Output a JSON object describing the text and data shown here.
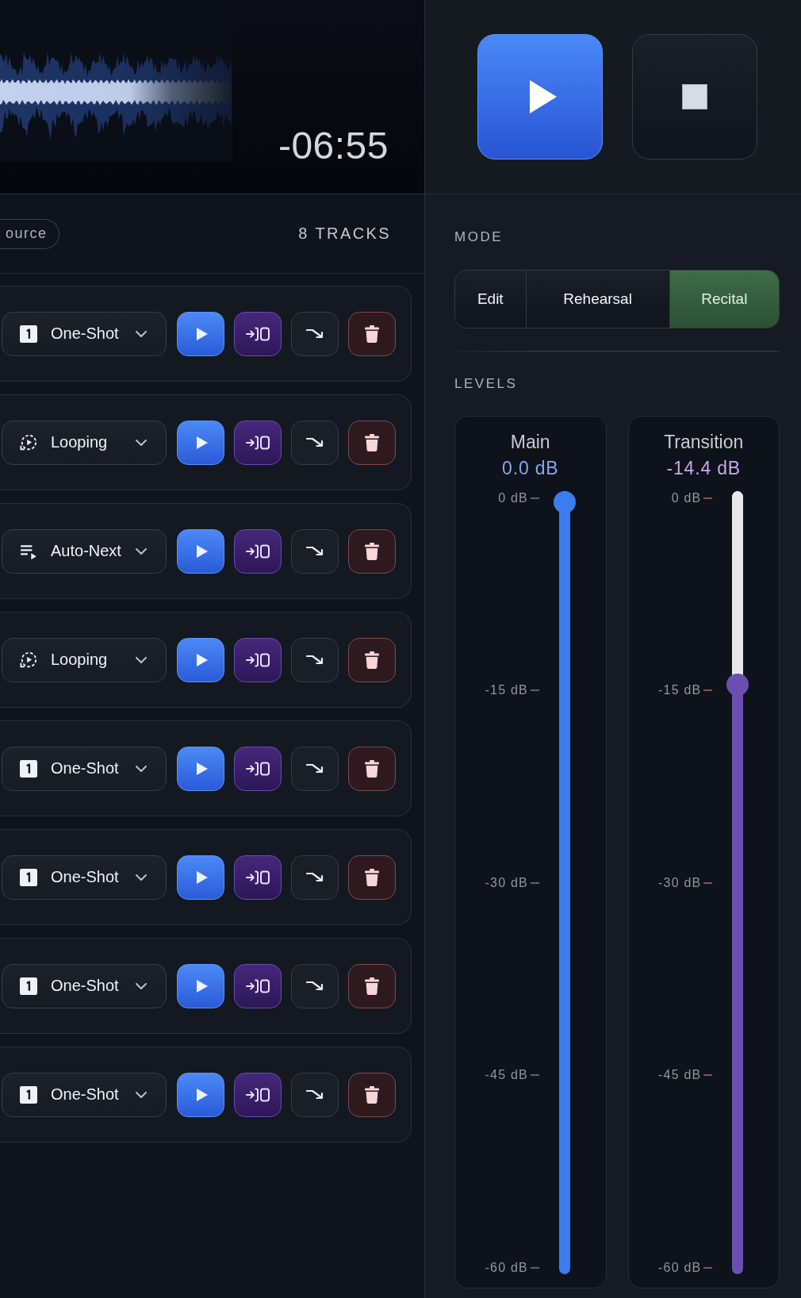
{
  "transport": {
    "time_remaining": "-06:55",
    "controls": [
      {
        "kind": "play"
      },
      {
        "kind": "stop"
      }
    ]
  },
  "tracks": {
    "source_chip": "ource",
    "count": "8 TRACKS",
    "items": [
      {
        "mode": {
          "kind": "one_shot",
          "label": "One-Shot"
        }
      },
      {
        "mode": {
          "kind": "looping",
          "label": "Looping"
        }
      },
      {
        "mode": {
          "kind": "auto_next",
          "label": "Auto-Next"
        }
      },
      {
        "mode": {
          "kind": "looping",
          "label": "Looping"
        }
      },
      {
        "mode": {
          "kind": "one_shot",
          "label": "One-Shot"
        }
      },
      {
        "mode": {
          "kind": "one_shot",
          "label": "One-Shot"
        }
      },
      {
        "mode": {
          "kind": "one_shot",
          "label": "One-Shot"
        }
      },
      {
        "mode": {
          "kind": "one_shot",
          "label": "One-Shot"
        }
      }
    ]
  },
  "mode": {
    "label": "MODE",
    "options": [
      {
        "label": "Edit",
        "selected": false
      },
      {
        "label": "Rehearsal",
        "selected": false
      },
      {
        "label": "Recital",
        "selected": true
      }
    ]
  },
  "levels": {
    "label": "LEVELS",
    "channels": [
      {
        "kind": "main",
        "name": "Main",
        "reading": "0.0 dB",
        "level": 1,
        "color": "#3b7cf0",
        "scale": [
          "0 dB",
          "-15 dB",
          "-30 dB",
          "-45 dB",
          "-60 dB"
        ]
      },
      {
        "kind": "transition",
        "name": "Transition",
        "reading": "-14.4 dB",
        "level": 0.76,
        "color": "#6b4fb0",
        "scale": [
          "0 dB",
          "-15 dB",
          "-30 dB",
          "-45 dB",
          "-60 dB"
        ]
      }
    ]
  }
}
